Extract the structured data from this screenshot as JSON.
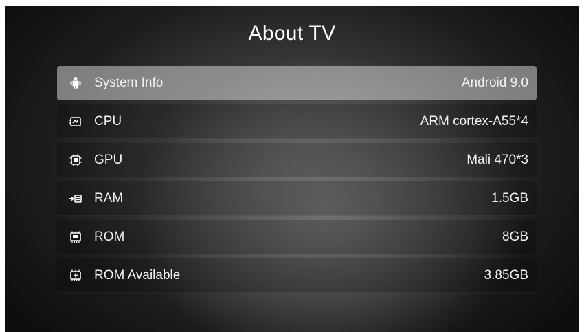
{
  "header": {
    "title": "About TV"
  },
  "rows": [
    {
      "icon": "android-icon",
      "label": "System Info",
      "value": "Android 9.0"
    },
    {
      "icon": "cpu-icon",
      "label": "CPU",
      "value": "ARM cortex-A55*4"
    },
    {
      "icon": "gpu-chip-icon",
      "label": "GPU",
      "value": "Mali 470*3"
    },
    {
      "icon": "ram-icon",
      "label": "RAM",
      "value": "1.5GB"
    },
    {
      "icon": "rom-icon",
      "label": "ROM",
      "value": "8GB"
    },
    {
      "icon": "rom-available-icon",
      "label": "ROM Available",
      "value": "3.85GB"
    }
  ],
  "selected_row": "System Info"
}
